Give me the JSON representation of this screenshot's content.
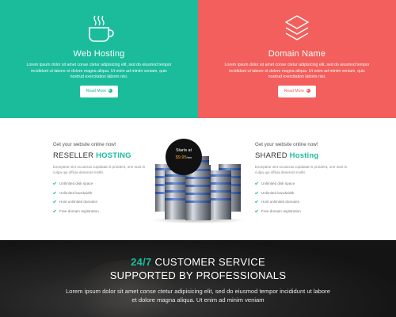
{
  "features": [
    {
      "id": "web-hosting",
      "icon": "coffee-cup-icon",
      "title": "Web Hosting",
      "description": "Lorem ipsum dolor sit amet conse ctetur adipisicing elit, sed do eiusmod tempor incididunt ut labore et dolore magna aliqua. Ut enim ad minim veniam, quis nostrud exercitation laboris nisi.",
      "button_label": "Read More",
      "color": "#1abc9c"
    },
    {
      "id": "domain-name",
      "icon": "layers-stack-icon",
      "title": "Domain Name",
      "description": "Lorem ipsum dolor sit amet conse ctetur adipisicing elit, sed do eiusmod tempor incididunt ut labore et dolore magna aliqua. Ut enim ad minim veniam, quis nostrud exercitation laboris nisi.",
      "button_label": "Read More",
      "color": "#f25f5c"
    }
  ],
  "reseller": {
    "tagline": "Get your website online now!",
    "name_plain": "RESELLER",
    "name_highlight": "HOSTING",
    "description": "Excepteur sint occaecat cupidatat is proident, one sunt in culpa qui officia deserunt mollit.",
    "features": [
      "Unlimited disk space",
      "Unlimited bandwidth",
      "Host unlimited domains",
      "Free domain registration"
    ]
  },
  "shared": {
    "tagline": "Get your website online now!",
    "name_plain": "SHARED",
    "name_highlight": "Hosting",
    "description": "Excepteur sint occaecat cupidatat is proident, one sunt in culpa qui officia deserunt mollit.",
    "features": [
      "Unlimited disk space",
      "Unlimited bandwidth",
      "Host unlimited domains",
      "Free domain registration"
    ]
  },
  "price_badge": {
    "label": "Starts at",
    "price": "$9.95",
    "unit": "/mo"
  },
  "service": {
    "heading_highlight": "24/7",
    "heading_rest": "CUSTOMER SERVICE",
    "subheading": "SUPPORTED BY PROFESSIONALS",
    "text": "Lorem ipsum dolor sit amet conse ctetur adipisicing elit, sed do eiusmod tempor incididunt ut labore et dolore magna aliqua. Ut enim ad minim veniam"
  },
  "colors": {
    "accent": "#1abc9c",
    "coral": "#f25f5c",
    "dark": "#1a1a1a",
    "badge_price": "#f5a623"
  }
}
